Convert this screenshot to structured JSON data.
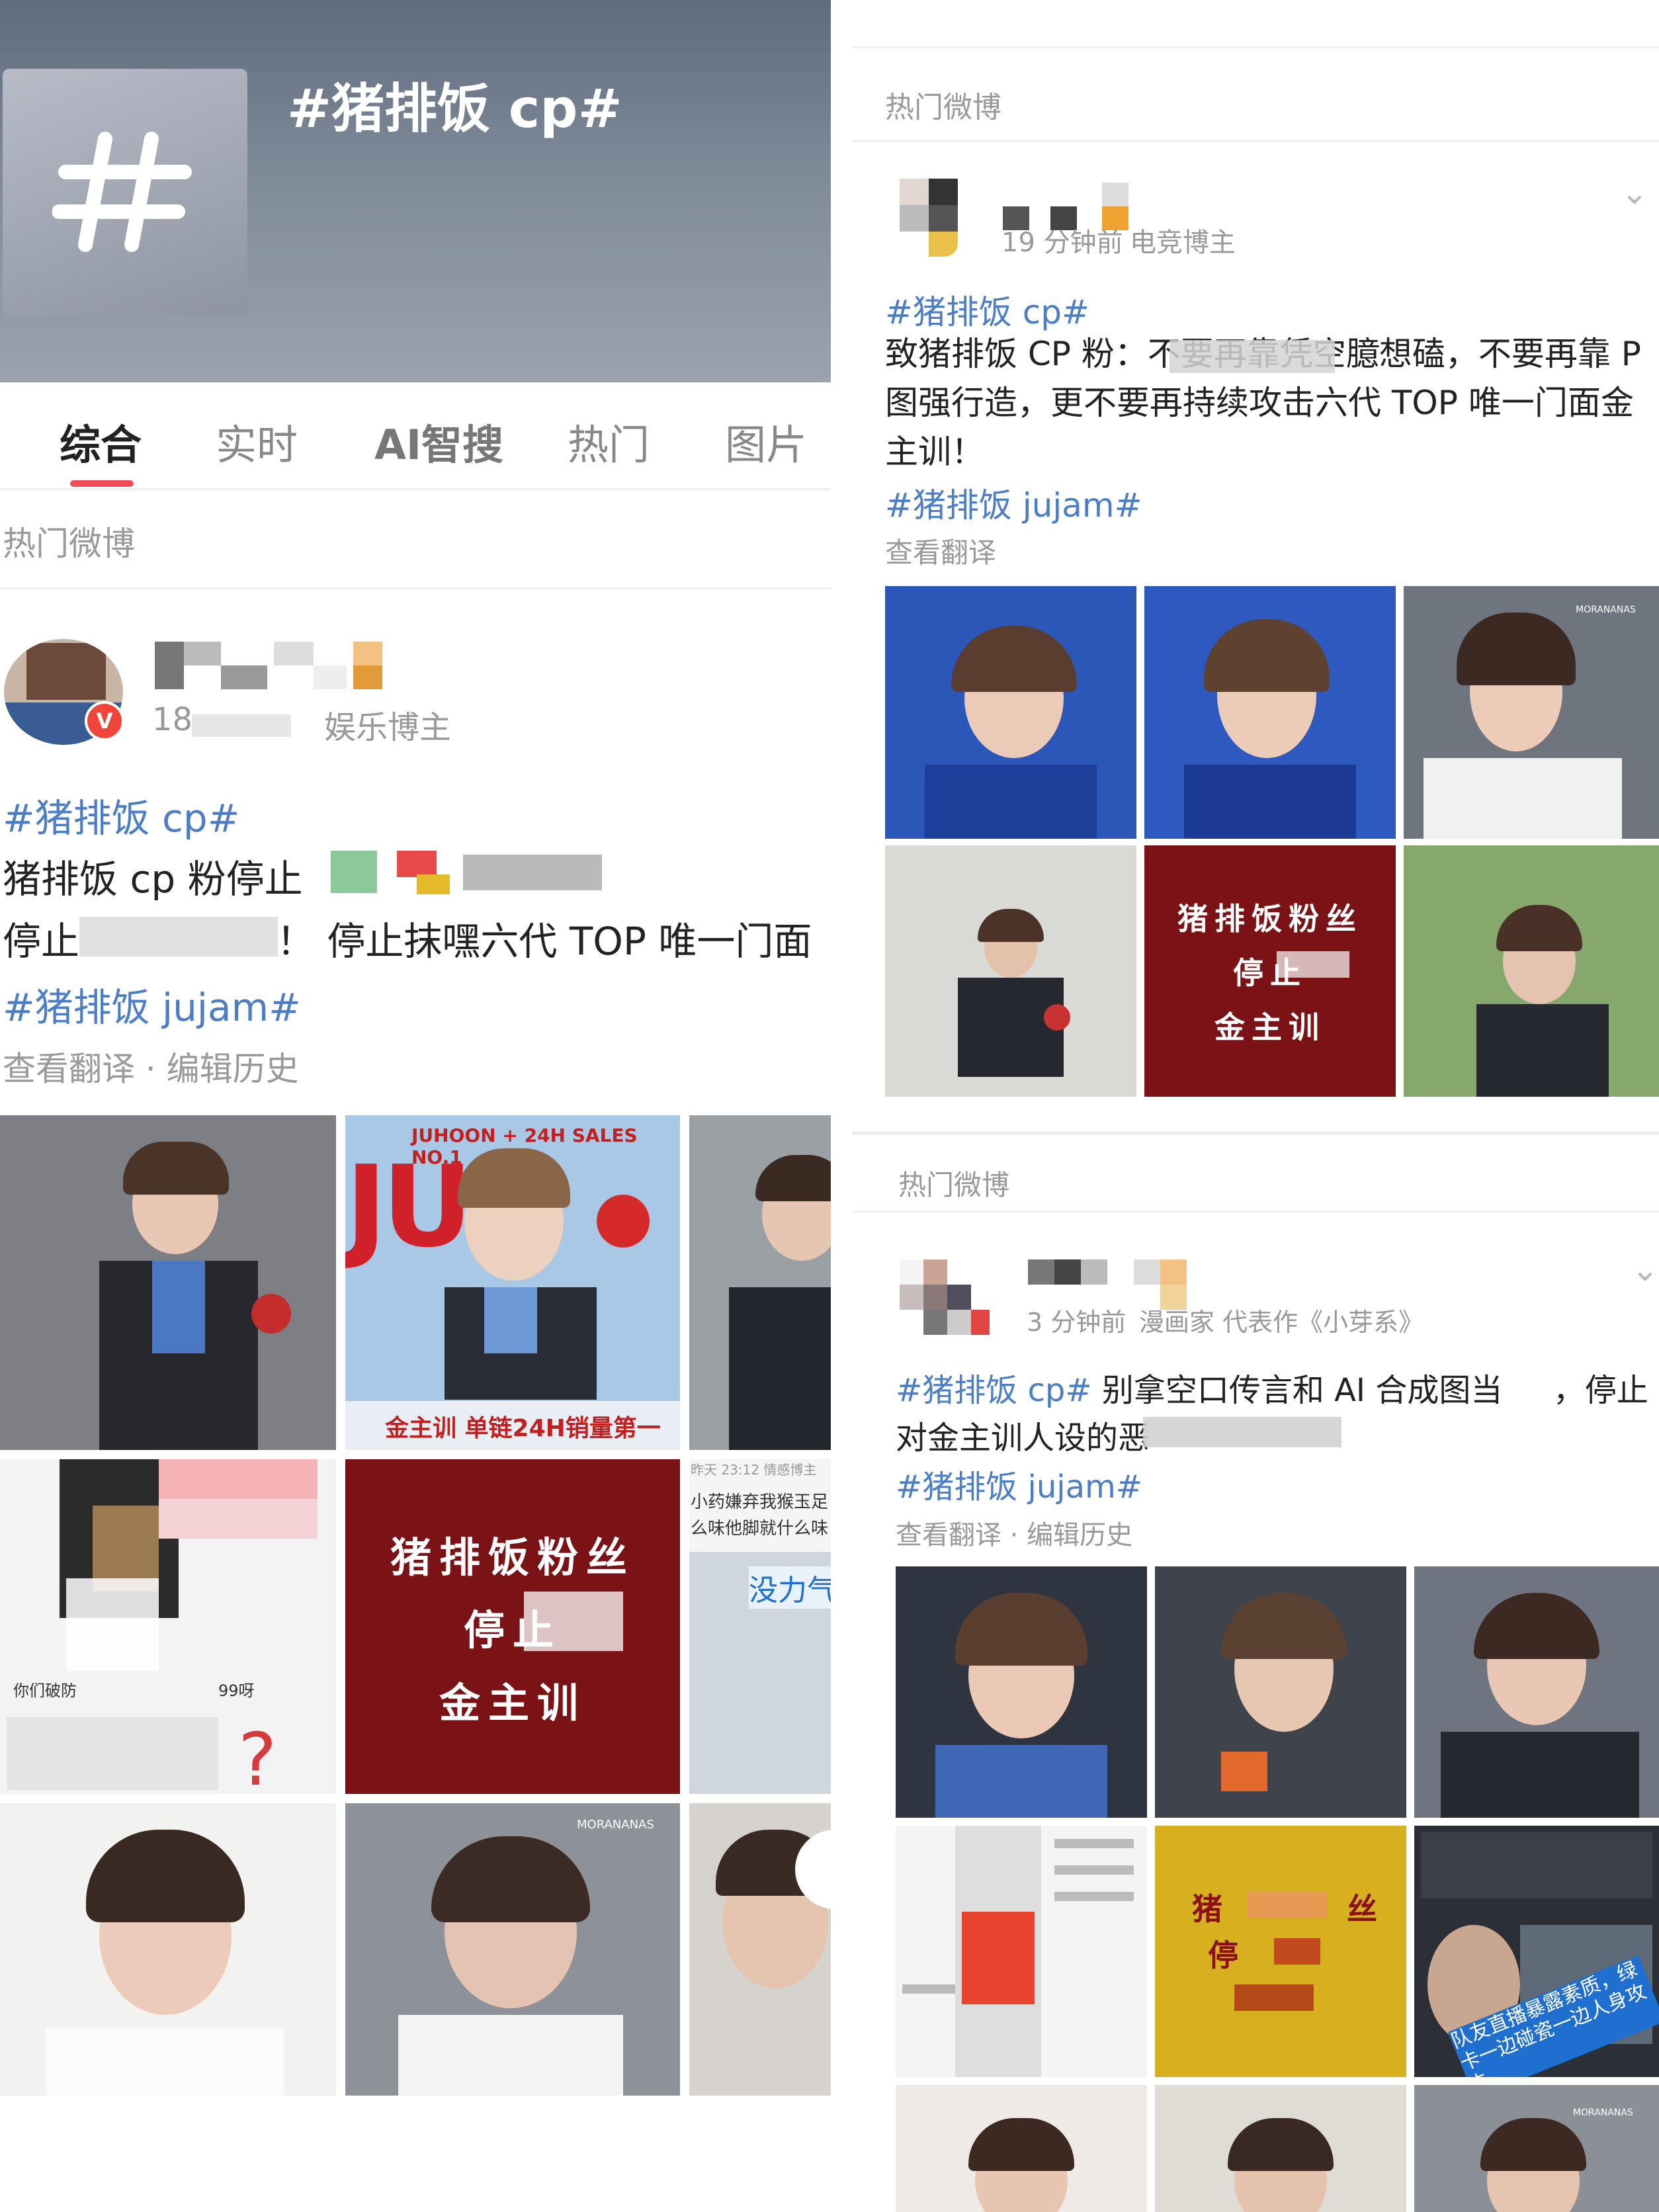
{
  "topic": {
    "title": "#猪排饭 cp#"
  },
  "tabs": [
    "综合",
    "实时",
    "AI智搜",
    "热门",
    "图片"
  ],
  "section_label": "热门微博",
  "left_post": {
    "time_fragment": "18",
    "role": "娱乐博主",
    "hashtag1": "#猪排饭 cp#",
    "line1": "猪排饭 cp 粉停止",
    "line2a": "停止",
    "line2b": "！ 停止抹嘿六代 TOP 唯一门面",
    "hashtag2": "#猪排饭 jujam#",
    "translate": "查看翻译 · 编辑历史",
    "poster_top": "JUHOON + 24H SALES NO.1",
    "poster_bottom": "金主训 单链24H销量第一",
    "red_card": [
      "猪排饭粉丝",
      "停止",
      "金主训"
    ],
    "comment_text": "你们破防",
    "comment_text2": "99呀",
    "side_text1": "小药嫌弃我猴玉足",
    "side_text2": "么味他脚就什么味",
    "side_time": "昨天 23:12  情感博主",
    "side_badge": "没力气",
    "watermark": "MORANANAS"
  },
  "right_post1": {
    "section_label": "热门微博",
    "time": "19 分钟前",
    "role": "电竞博主",
    "hashtag1": "#猪排饭 cp#",
    "text": "致猪排饭 CP 粉：不要再靠凭空臆想磕，不要再靠 P 图强行造，更不要再持续攻击六代 TOP 唯一门面金主训！",
    "hashtag2": "#猪排饭 jujam#",
    "translate": "查看翻译",
    "red_card": [
      "猪排饭粉丝",
      "停止",
      "金主训"
    ],
    "watermark": "MORANANAS"
  },
  "right_post2": {
    "section_label": "热门微博",
    "time": "3 分钟前",
    "role": "漫画家 代表作《小芽系》",
    "hashtag1": "#猪排饭 cp#",
    "text1": "别拿空口传言和 AI 合成图当",
    "text2": "，停止",
    "line2": "对金主训人设的恶",
    "hashtag2": "#猪排饭 jujam#",
    "translate": "查看翻译 · 编辑历史",
    "yellow_card": [
      "猪",
      "丝",
      "停"
    ],
    "caption_overlay": "队友直播暴露素质，绿卡一边碰瓷一边人身攻击",
    "watermark": "MORANANAS"
  },
  "colors": {
    "accent": "#f04c5c",
    "link": "#4b7ec7",
    "muted": "#999999"
  },
  "icons": [
    "hash-icon",
    "chevron-down-icon",
    "verified-icon"
  ]
}
